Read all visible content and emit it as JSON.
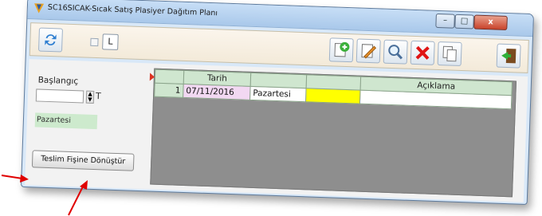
{
  "window": {
    "title": "SC16SICAK-Sıcak Satış Plasiyer Dağıtım Planı",
    "min_glyph": "–",
    "max_glyph": "□",
    "close_glyph": "x"
  },
  "toolbar": {
    "l_button_label": "L",
    "icons": [
      "refresh-icon",
      "add-icon",
      "edit-icon",
      "search-icon",
      "delete-icon",
      "copy-icon",
      "exit-icon"
    ]
  },
  "left_panel": {
    "start_label": "Başlangıç",
    "start_date_value": "",
    "t_label": "T",
    "day_value": "Pazartesi",
    "convert_button_label": "Teslim Fişine Dönüştür"
  },
  "grid": {
    "columns": [
      "",
      "Tarih",
      "",
      "",
      "Açıklama"
    ],
    "rows": [
      {
        "index": "1",
        "date": "07/11/2016",
        "day": "Pazartesi",
        "flag": "",
        "note": ""
      }
    ]
  },
  "colors": {
    "annotation_arrow": "#e00000",
    "highlight_yellow": "#ffff00",
    "grid_header": "#cfe6cf"
  }
}
